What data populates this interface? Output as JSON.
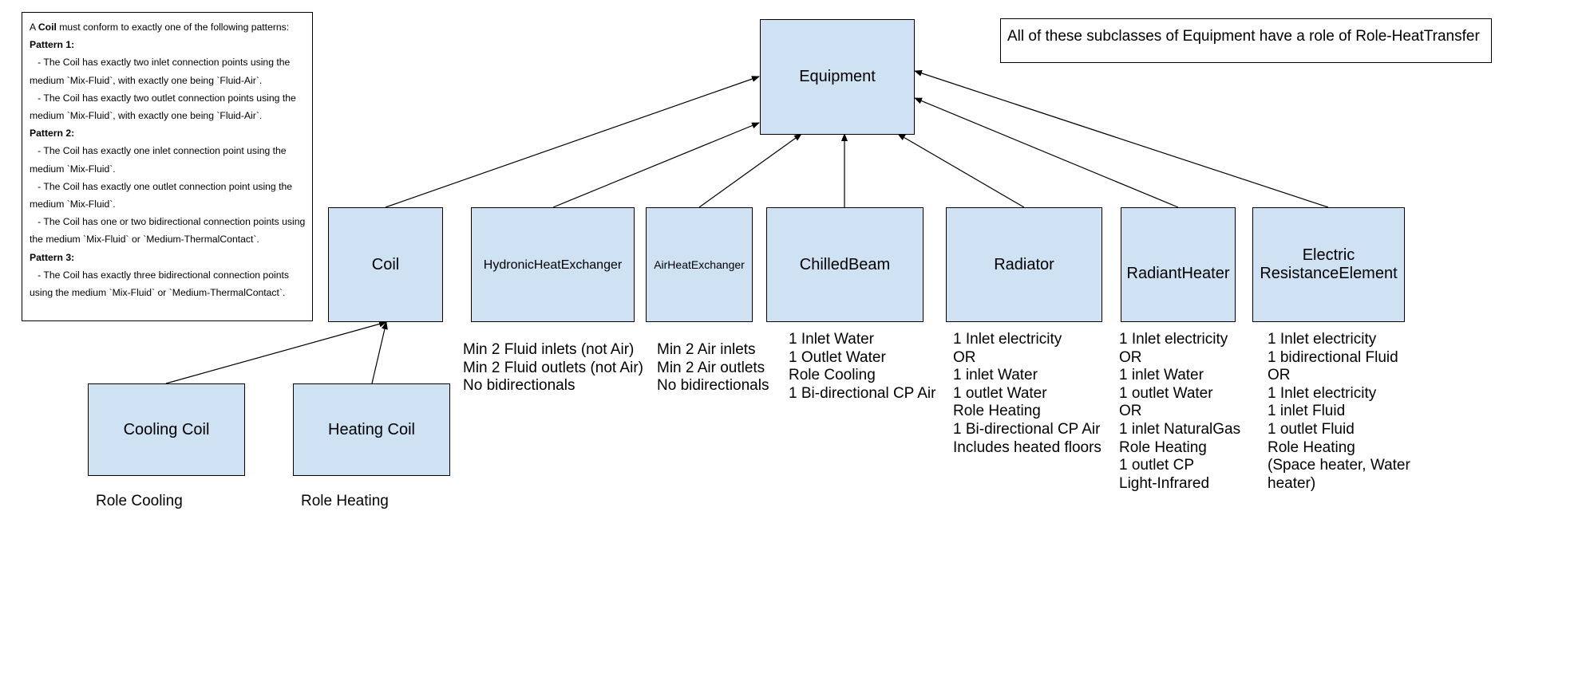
{
  "coil_note": {
    "intro_prefix": "A ",
    "intro_bold": "Coil",
    "intro_suffix": " must conform to exactly one of the following patterns:",
    "patterns": [
      {
        "title": "Pattern 1:",
        "lines": [
          "   - The Coil has exactly two inlet connection points using the",
          "medium `Mix-Fluid`, with exactly one being `Fluid-Air`.",
          "   - The Coil has exactly two outlet connection points using the",
          "medium `Mix-Fluid`, with exactly one being `Fluid-Air`."
        ]
      },
      {
        "title": "Pattern 2:",
        "lines": [
          "   - The Coil has exactly one inlet connection point using the",
          "medium `Mix-Fluid`.",
          "   - The Coil has exactly one outlet connection point using the",
          "medium `Mix-Fluid`.",
          "   - The Coil has one or two bidirectional connection points using",
          "the medium `Mix-Fluid` or `Medium-ThermalContact`."
        ]
      },
      {
        "title": "Pattern 3:",
        "lines": [
          "   - The Coil has exactly three bidirectional connection points",
          "using the medium `Mix-Fluid` or `Medium-ThermalContact`."
        ]
      }
    ]
  },
  "role_note": "All of these subclasses of Equipment have a role of Role-HeatTransfer",
  "colors": {
    "box_fill": "#cfe2f3",
    "stroke": "#000000"
  },
  "nodes": {
    "equipment": "Equipment",
    "coil": "Coil",
    "hydronic": "HydronicHeatExchanger",
    "air_hx": "AirHeatExchanger",
    "chilled_beam": "ChilledBeam",
    "radiator": "Radiator",
    "radiant_heater": "RadiantHeater",
    "ere_line1": "Electric",
    "ere_line2": "ResistanceElement",
    "cooling_coil": "Cooling Coil",
    "heating_coil": "Heating Coil"
  },
  "descriptions": {
    "hydronic": [
      "Min 2 Fluid inlets (not Air)",
      "Min 2 Fluid outlets (not Air)",
      "No bidirectionals"
    ],
    "air_hx": [
      "Min 2 Air inlets",
      "Min 2 Air outlets",
      "No bidirectionals"
    ],
    "chilled_beam": [
      "1 Inlet Water",
      "1 Outlet Water",
      "Role Cooling",
      "1 Bi-directional CP Air"
    ],
    "radiator": [
      "1 Inlet electricity",
      "OR",
      "1 inlet Water",
      "1 outlet Water",
      "Role Heating",
      "1 Bi-directional CP Air",
      "Includes heated floors"
    ],
    "radiant_heater": [
      "1 Inlet electricity",
      "OR",
      "1 inlet Water",
      "1 outlet Water",
      "OR",
      "1 inlet NaturalGas",
      "Role Heating",
      "1 outlet CP",
      "Light-Infrared"
    ],
    "ere": [
      "1 Inlet electricity",
      "1 bidirectional Fluid",
      "OR",
      "1 Inlet electricity",
      "1 inlet Fluid",
      "1 outlet Fluid",
      "Role Heating",
      "(Space heater, Water",
      "heater)"
    ],
    "cooling_coil": [
      "Role Cooling"
    ],
    "heating_coil": [
      "Role Heating"
    ]
  },
  "edges": [
    {
      "from": "coil",
      "to": "equipment"
    },
    {
      "from": "hydronic",
      "to": "equipment"
    },
    {
      "from": "air_hx",
      "to": "equipment"
    },
    {
      "from": "chilled_beam",
      "to": "equipment"
    },
    {
      "from": "radiator",
      "to": "equipment"
    },
    {
      "from": "radiant_heater",
      "to": "equipment"
    },
    {
      "from": "ere",
      "to": "equipment"
    },
    {
      "from": "cooling_coil",
      "to": "coil"
    },
    {
      "from": "heating_coil",
      "to": "coil"
    }
  ]
}
